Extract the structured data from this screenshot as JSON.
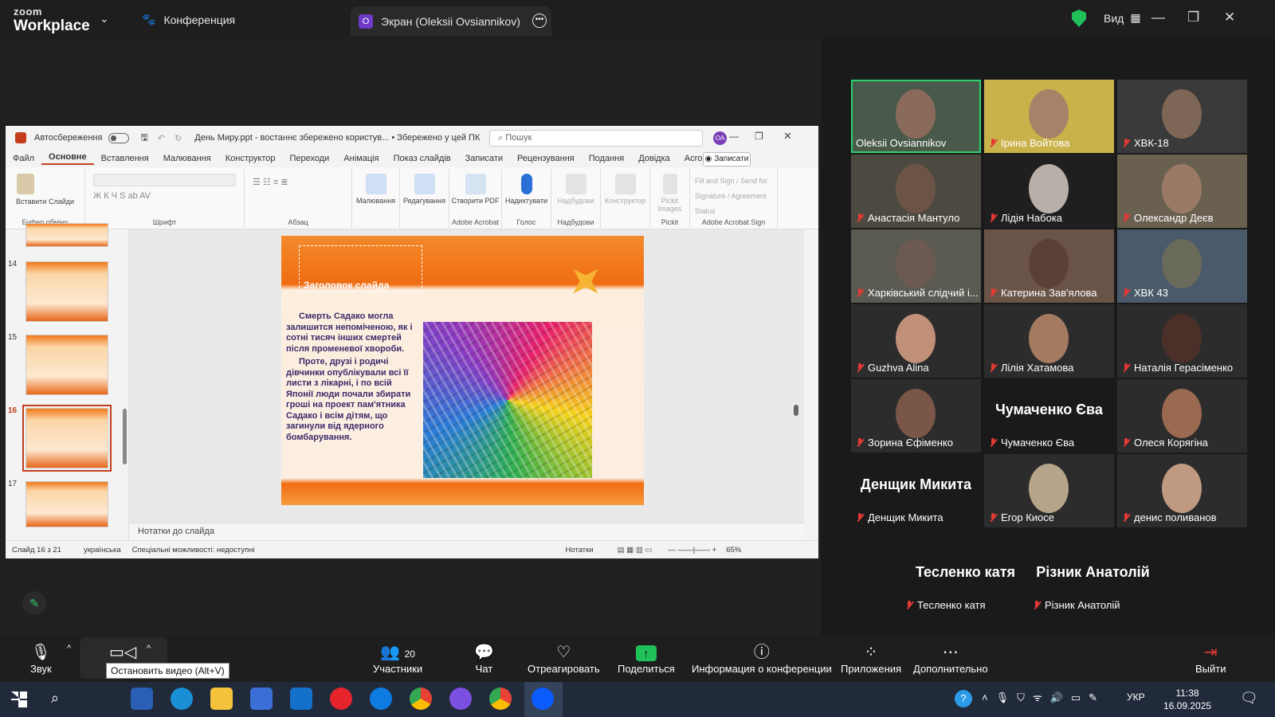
{
  "topbar": {
    "logo_top": "zoom",
    "logo_bottom": "Workplace",
    "conference_tab": "Конференция",
    "screen_tab": "Экран (Oleksii Ovsiannikov)",
    "screen_badge": "O",
    "view_label": "Вид"
  },
  "ppt": {
    "autosave_label": "Автосбереження",
    "doc_title": "День Миру.ppt  -  востаннє збережено користув...  •  Збережено у цей ПК",
    "search_placeholder": "Пошук",
    "avatar": "OA",
    "menu": [
      "Файл",
      "Основне",
      "Вставлення",
      "Малювання",
      "Конструктор",
      "Переходи",
      "Анімація",
      "Показ слайдів",
      "Записати",
      "Рецензування",
      "Подання",
      "Довідка",
      "Acrobat"
    ],
    "record_label": "Записати",
    "ribbon_groups": [
      {
        "buttons": "Вставити  Слайди",
        "label": "Буфер обміну"
      },
      {
        "buttons": "",
        "label": "Шрифт"
      },
      {
        "buttons": "",
        "label": "Абзац"
      },
      {
        "buttons": "Малювання",
        "label": ""
      },
      {
        "buttons": "Редагування",
        "label": ""
      },
      {
        "buttons": "Створити PDF",
        "label": "Adobe Acrobat"
      },
      {
        "buttons": "Надиктувати",
        "label": "Голос"
      },
      {
        "buttons": "Надбудови",
        "label": "Надбудови"
      },
      {
        "buttons": "Конструктор",
        "label": ""
      },
      {
        "buttons": "Pickit Images",
        "label": "Pickit"
      },
      {
        "buttons": "Fill and Sign / Send for Signature / Agreement Status",
        "label": "Adobe Acrobat Sign"
      }
    ],
    "thumb_numbers": [
      "14",
      "15",
      "16",
      "17"
    ],
    "slide": {
      "title_placeholder": "Заголовок слайда",
      "para1": "Смерть Садако могла залишится непоміченою, як і сотні тисяч інших смертей після променевої хвороби.",
      "para2": "Проте, друзі і родичі дівчинки опублікували всі її листи з лікарні, і по всій Японії люди почали збирати гроші на проект пам'ятника Садако і всім дітям, що загинули від ядерного бомбарування."
    },
    "notes_placeholder": "Нотатки до слайда",
    "status": {
      "slide_of": "Слайд 16 з 21",
      "language": "українська",
      "accessibility": "Спеціальні можливості: недоступні",
      "notes": "Нотатки",
      "zoom": "65%"
    }
  },
  "participants": [
    {
      "name": "Oleksii Ovsiannikov",
      "muted": false,
      "active": true
    },
    {
      "name": "Ірина Войтова",
      "muted": true
    },
    {
      "name": "ХВК-18",
      "muted": true
    },
    {
      "name": "Анастасія Мантуло",
      "muted": true
    },
    {
      "name": "Лідія Набока",
      "muted": true
    },
    {
      "name": "Олександр Деєв",
      "muted": true
    },
    {
      "name": "Харківський слідчий і...",
      "muted": true
    },
    {
      "name": "Катерина Зав'ялова",
      "muted": true
    },
    {
      "name": "ХВК 43",
      "muted": true
    },
    {
      "name": "Guzhva Alina",
      "muted": true
    },
    {
      "name": "Лілія Хатамова",
      "muted": true
    },
    {
      "name": "Наталія Герасіменко",
      "muted": true
    },
    {
      "name": "Зорина  Єфіменко",
      "muted": true
    },
    {
      "name": "Чумаченко Єва",
      "muted": true,
      "big": "Чумаченко Єва"
    },
    {
      "name": "Олеся Корягіна",
      "muted": true
    },
    {
      "name": "Денщик Микита",
      "muted": true,
      "big": "Денщик Микита"
    },
    {
      "name": "Егор Киосе",
      "muted": true
    },
    {
      "name": "денис поливанов",
      "muted": true
    },
    {
      "name": "Тесленко катя",
      "muted": true,
      "big": "Тесленко катя"
    },
    {
      "name": "Різник Анатолій",
      "muted": true,
      "big": "Різник Анатолій"
    }
  ],
  "toolbar": {
    "audio": "Звук",
    "video_tooltip": "Остановить видео (Alt+V)",
    "participants": "Участники",
    "participants_count": "20",
    "chat": "Чат",
    "react": "Отреагировать",
    "share": "Поделиться",
    "info": "Информация о конференции",
    "apps": "Приложения",
    "more": "Дополнительно",
    "leave": "Выйти"
  },
  "taskbar": {
    "lang": "УКР",
    "time": "11:38",
    "date": "16.09.2025"
  },
  "colors": {
    "zoom_green": "#20c15a",
    "ppt_accent": "#c43e1c",
    "active_border": "#2ed06e",
    "mute_red": "#e53935"
  }
}
